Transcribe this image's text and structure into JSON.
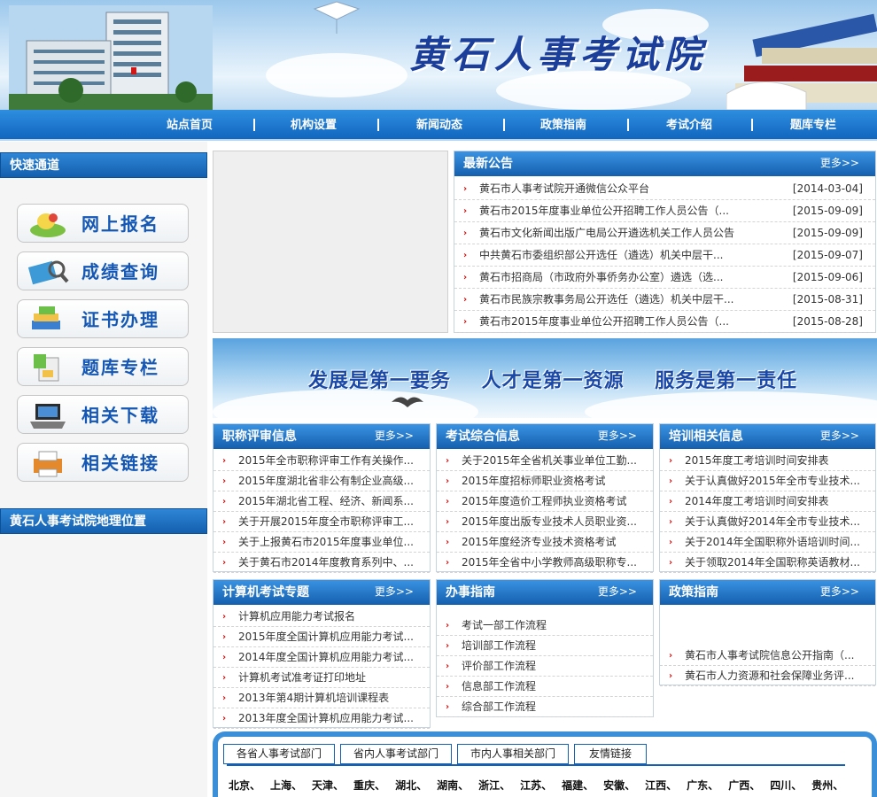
{
  "header": {
    "title": "黄石人事考试院"
  },
  "nav": {
    "items": [
      "站点首页",
      "机构设置",
      "新闻动态",
      "政策指南",
      "考试介绍",
      "题库专栏"
    ]
  },
  "left": {
    "quick_title": "快速通道",
    "quick_links": [
      {
        "label": "网上报名",
        "icon": "register-icon"
      },
      {
        "label": "成绩查询",
        "icon": "score-search-icon"
      },
      {
        "label": "证书办理",
        "icon": "certificate-icon"
      },
      {
        "label": "题库专栏",
        "icon": "question-bank-icon"
      },
      {
        "label": "相关下载",
        "icon": "laptop-download-icon"
      },
      {
        "label": "相关链接",
        "icon": "printer-link-icon"
      }
    ],
    "location_title": "黄石人事考试院地理位置"
  },
  "notice": {
    "title": "最新公告",
    "more": "更多>>",
    "items": [
      {
        "text": "黄石市人事考试院开通微信公众平台",
        "date": "[2014-03-04]"
      },
      {
        "text": "黄石市2015年度事业单位公开招聘工作人员公告（...",
        "date": "[2015-09-09]"
      },
      {
        "text": "黄石市文化新闻出版广电局公开遴选机关工作人员公告",
        "date": "[2015-09-09]"
      },
      {
        "text": "中共黄石市委组织部公开选任（遴选）机关中层干...",
        "date": "[2015-09-07]"
      },
      {
        "text": "黄石市招商局（市政府外事侨务办公室）遴选（选...",
        "date": "[2015-09-06]"
      },
      {
        "text": "黄石市民族宗教事务局公开选任（遴选）机关中层干...",
        "date": "[2015-08-31]"
      },
      {
        "text": "黄石市2015年度事业单位公开招聘工作人员公告（...",
        "date": "[2015-08-28]"
      }
    ]
  },
  "banner": {
    "slogan": "发展是第一要务    人才是第一资源    服务是第一责任"
  },
  "panels": {
    "title_review": {
      "title": "职称评审信息",
      "more": "更多>>",
      "items": [
        "2015年全市职称评审工作有关操作...",
        "2015年度湖北省非公有制企业高级...",
        "2015年湖北省工程、经济、新闻系...",
        "关于开展2015年度全市职称评审工...",
        "关于上报黄石市2015年度事业单位...",
        "关于黄石市2014年度教育系列中、..."
      ]
    },
    "exam_info": {
      "title": "考试综合信息",
      "more": "更多>>",
      "items": [
        "关于2015年全省机关事业单位工勤...",
        "2015年度招标师职业资格考试",
        "2015年度造价工程师执业资格考试",
        "2015年度出版专业技术人员职业资...",
        "2015年度经济专业技术资格考试",
        "2015年全省中小学教师高级职称专..."
      ]
    },
    "training": {
      "title": "培训相关信息",
      "more": "更多>>",
      "items": [
        "2015年度工考培训时间安排表",
        "关于认真做好2015年全市专业技术...",
        "2014年度工考培训时间安排表",
        "关于认真做好2014年全市专业技术...",
        "关于2014年全国职称外语培训时间...",
        "关于领取2014年全国职称英语教材..."
      ]
    },
    "computer": {
      "title": "计算机考试专题",
      "more": "更多>>",
      "items": [
        "计算机应用能力考试报名",
        "2015年度全国计算机应用能力考试...",
        "2014年度全国计算机应用能力考试...",
        "计算机考试准考证打印地址",
        "2013年第4期计算机培训课程表",
        "2013年度全国计算机应用能力考试..."
      ]
    },
    "guide": {
      "title": "办事指南",
      "more": "更多>>",
      "items": [
        "考试一部工作流程",
        "培训部工作流程",
        "评价部工作流程",
        "信息部工作流程",
        "综合部工作流程"
      ]
    },
    "policy": {
      "title": "政策指南",
      "more": "更多>>",
      "items": [
        "黄石市人事考试院信息公开指南（...",
        "黄石市人力资源和社会保障业务评..."
      ]
    }
  },
  "links": {
    "tabs": [
      "各省人事考试部门",
      "省内人事考试部门",
      "市内人事相关部门",
      "友情链接"
    ],
    "provinces": [
      "北京、",
      "上海、",
      "天津、",
      "重庆、",
      "湖北、",
      "湖南、",
      "浙江、",
      "江苏、",
      "福建、",
      "安徽、",
      "江西、",
      "广东、",
      "广西、",
      "四川、",
      "贵州、"
    ]
  },
  "colors": {
    "nav_blue": "#1a74cf",
    "title_blue": "#1a3e9a",
    "arrow_red": "#cc1111"
  }
}
